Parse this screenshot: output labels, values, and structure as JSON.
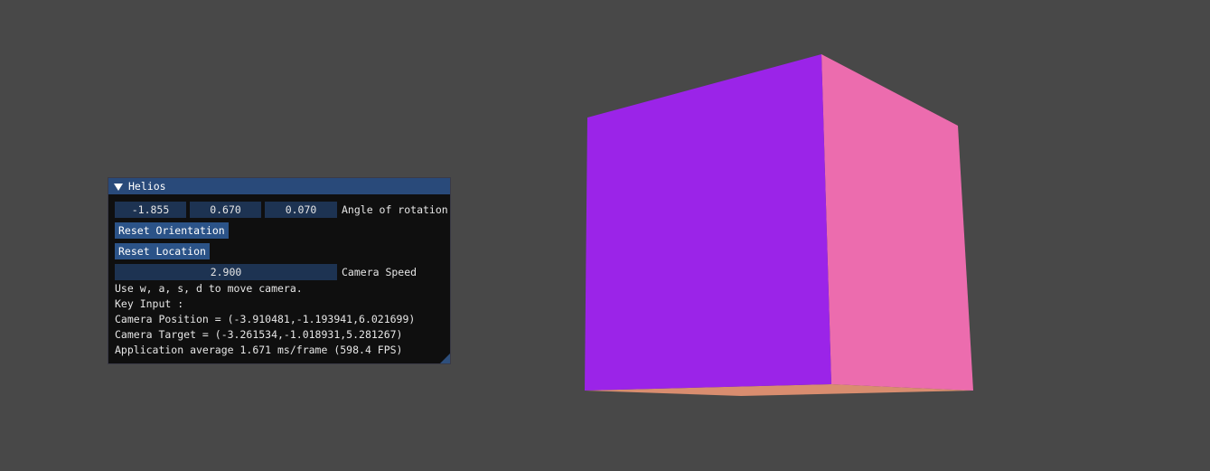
{
  "scene": {
    "background_color": "#484848",
    "cube": {
      "front_face_color": "#9b24e8",
      "side_face_color": "#ec6cae",
      "bottom_face_color": "#d98d6f"
    }
  },
  "window": {
    "title": "Helios",
    "collapse_icon": "triangle-down-icon",
    "rotation": {
      "x": "-1.855",
      "y": "0.670",
      "z": "0.070",
      "label": "Angle of rotation"
    },
    "reset_orientation_label": "Reset Orientation",
    "reset_location_label": "Reset Location",
    "camera_speed": {
      "value": "2.900",
      "label": "Camera Speed"
    },
    "help_text": "Use w, a, s, d to move camera.",
    "key_input_text": "Key Input :",
    "camera_position_text": "Camera Position = (-3.910481,-1.193941,6.021699)",
    "camera_target_text": "Camera Target = (-3.261534,-1.018931,5.281267)",
    "fps_text": "Application average 1.671 ms/frame (598.4 FPS)"
  }
}
